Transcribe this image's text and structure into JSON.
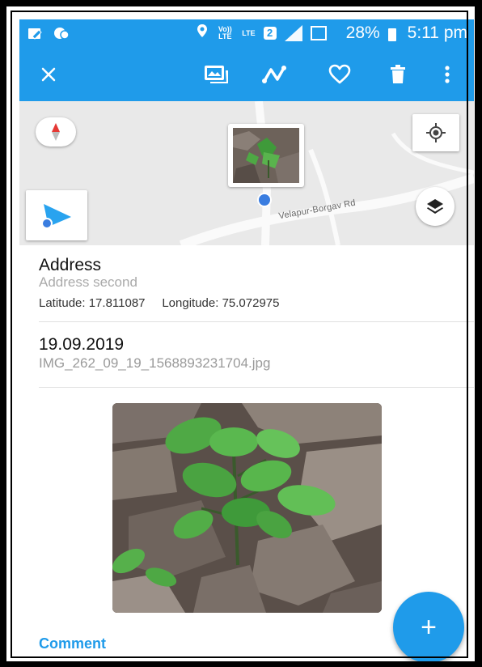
{
  "status_bar": {
    "volte": "Vo)) LTE",
    "lte": "LTE",
    "sim_slot": "2",
    "battery": "28%",
    "time": "5:11 pm"
  },
  "toolbar": {
    "icons": [
      "close-icon",
      "gallery-icon",
      "route-icon",
      "favorite-icon",
      "delete-icon",
      "more-vert-icon"
    ]
  },
  "map": {
    "road_name": "Velapur-Borgav Rd"
  },
  "details": {
    "address_title": "Address",
    "address_second": "Address second",
    "coordinates": "Latitude: 17.811087     Longitude: 75.072975",
    "date": "19.09.2019",
    "filename": "IMG_262_09_19_1568893231704.jpg",
    "comment_label": "Comment"
  },
  "fab": {
    "label": "+"
  },
  "colors": {
    "accent": "#1f9bea",
    "map_background": "#e9e9e9",
    "marker": "#3a7de0"
  }
}
